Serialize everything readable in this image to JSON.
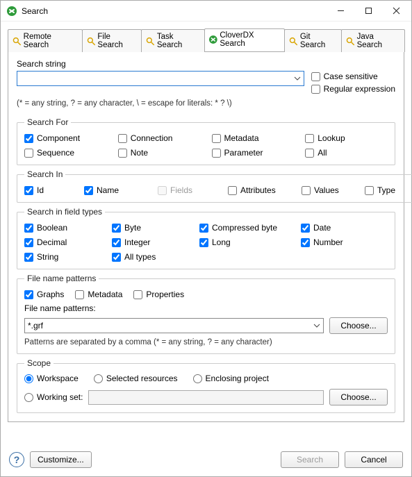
{
  "window": {
    "title": "Search"
  },
  "tabs": [
    {
      "label": "Remote Search"
    },
    {
      "label": "File Search"
    },
    {
      "label": "Task Search"
    },
    {
      "label": "CloverDX Search",
      "active": true
    },
    {
      "label": "Git Search"
    },
    {
      "label": "Java Search"
    }
  ],
  "searchString": {
    "label": "Search string",
    "value": "",
    "caseSensitive": "Case sensitive",
    "regex": "Regular expression",
    "hint": "(* = any string, ? = any character, \\ = escape for literals: * ? \\)"
  },
  "searchFor": {
    "legend": "Search For",
    "items": [
      {
        "label": "Component",
        "checked": true
      },
      {
        "label": "Connection",
        "checked": false
      },
      {
        "label": "Metadata",
        "checked": false
      },
      {
        "label": "Lookup",
        "checked": false
      },
      {
        "label": "Sequence",
        "checked": false
      },
      {
        "label": "Note",
        "checked": false
      },
      {
        "label": "Parameter",
        "checked": false
      },
      {
        "label": "All",
        "checked": false
      }
    ]
  },
  "searchIn": {
    "legend": "Search In",
    "items": [
      {
        "label": "Id",
        "checked": true
      },
      {
        "label": "Name",
        "checked": true
      },
      {
        "label": "Fields",
        "checked": false,
        "disabled": true
      },
      {
        "label": "Attributes",
        "checked": false
      },
      {
        "label": "Values",
        "checked": false
      },
      {
        "label": "Type",
        "checked": false
      }
    ]
  },
  "fieldTypes": {
    "legend": "Search in field types",
    "items": [
      {
        "label": "Boolean",
        "checked": true
      },
      {
        "label": "Byte",
        "checked": true
      },
      {
        "label": "Compressed byte",
        "checked": true
      },
      {
        "label": "Date",
        "checked": true
      },
      {
        "label": "Decimal",
        "checked": true
      },
      {
        "label": "Integer",
        "checked": true
      },
      {
        "label": "Long",
        "checked": true
      },
      {
        "label": "Number",
        "checked": true
      },
      {
        "label": "String",
        "checked": true
      },
      {
        "label": "All types",
        "checked": true
      }
    ]
  },
  "filePatterns": {
    "legend": "File name patterns",
    "checks": [
      {
        "label": "Graphs",
        "checked": true
      },
      {
        "label": "Metadata",
        "checked": false
      },
      {
        "label": "Properties",
        "checked": false
      }
    ],
    "inputLabel": "File name patterns:",
    "value": "*.grf",
    "choose": "Choose...",
    "note": "Patterns are separated by a comma (* = any string, ? = any character)"
  },
  "scope": {
    "legend": "Scope",
    "workspace": "Workspace",
    "selected": "Selected resources",
    "enclosing": "Enclosing project",
    "workingSet": "Working set:",
    "workingSetValue": "",
    "choose": "Choose..."
  },
  "footer": {
    "customize": "Customize...",
    "search": "Search",
    "cancel": "Cancel"
  }
}
